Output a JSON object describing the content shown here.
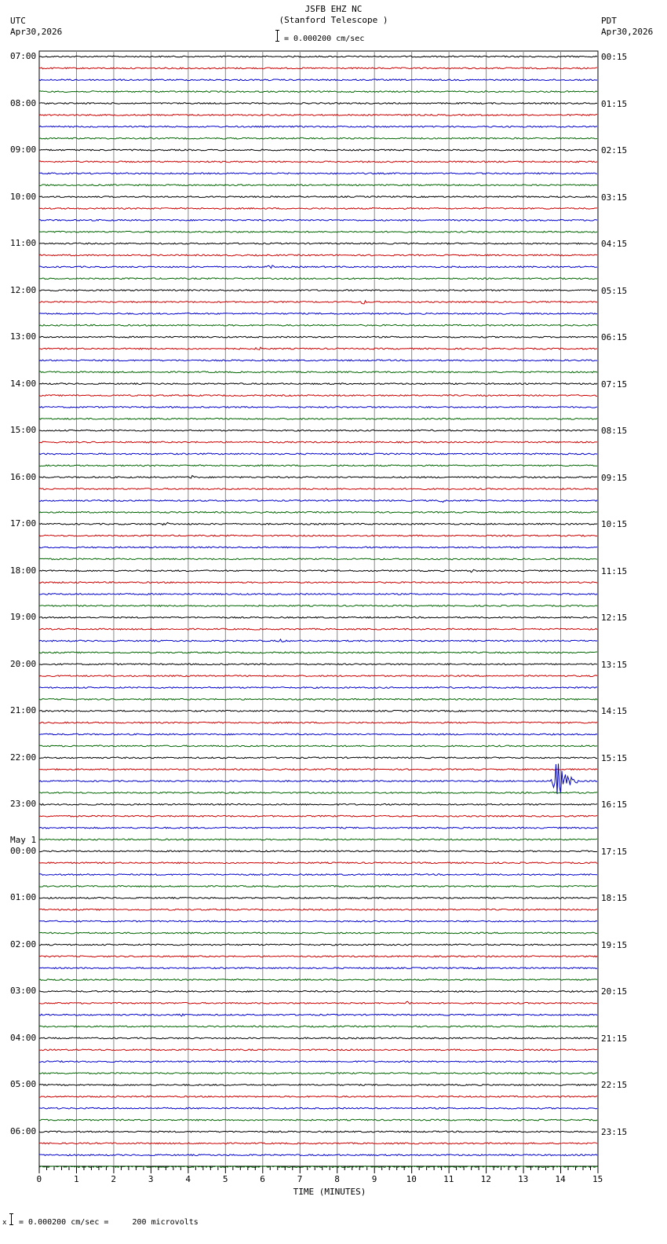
{
  "header": {
    "station": "JSFB EHZ NC",
    "site": "(Stanford Telescope )",
    "scale_text": "= 0.000200 cm/sec",
    "left_tz": "UTC",
    "left_date": "Apr30,2026",
    "right_tz": "PDT",
    "right_date": "Apr30,2026"
  },
  "footer": {
    "scale_text": "= 0.000200 cm/sec =     200 microvolts",
    "marker": "x"
  },
  "chart_data": {
    "type": "line",
    "title": "JSFB EHZ NC (Stanford Telescope )",
    "xlabel": "TIME (MINUTES)",
    "ylabel": "",
    "xlim": [
      0,
      15
    ],
    "x_ticks": [
      "0",
      "1",
      "2",
      "3",
      "4",
      "5",
      "6",
      "7",
      "8",
      "9",
      "10",
      "11",
      "12",
      "13",
      "14",
      "15"
    ],
    "grid": true,
    "trace_count": 96,
    "traces_per_hour": 4,
    "trace_colors": [
      "#000000",
      "#cc0000",
      "#0000cc",
      "#006600"
    ],
    "hour_labels_utc": [
      "07:00",
      "08:00",
      "09:00",
      "10:00",
      "11:00",
      "12:00",
      "13:00",
      "14:00",
      "15:00",
      "16:00",
      "17:00",
      "18:00",
      "19:00",
      "20:00",
      "21:00",
      "22:00",
      "23:00",
      "00:00",
      "01:00",
      "02:00",
      "03:00",
      "04:00",
      "05:00",
      "06:00"
    ],
    "date_change_label": "May 1",
    "hour_labels_pdt": [
      "00:15",
      "01:15",
      "02:15",
      "03:15",
      "04:15",
      "05:15",
      "06:15",
      "07:15",
      "08:15",
      "09:15",
      "10:15",
      "11:15",
      "12:15",
      "13:15",
      "14:15",
      "15:15",
      "16:15",
      "17:15",
      "18:15",
      "19:15",
      "20:15",
      "21:15",
      "22:15",
      "23:15"
    ],
    "events": [
      {
        "trace": 62,
        "minute": 13.9,
        "amplitude": "large",
        "color": "#0000cc"
      },
      {
        "trace": 18,
        "minute": 6.2,
        "amplitude": "small"
      },
      {
        "trace": 21,
        "minute": 8.7,
        "amplitude": "small"
      },
      {
        "trace": 25,
        "minute": 5.9,
        "amplitude": "small"
      },
      {
        "trace": 36,
        "minute": 4.1,
        "amplitude": "small"
      },
      {
        "trace": 38,
        "minute": 10.8,
        "amplitude": "small"
      },
      {
        "trace": 40,
        "minute": 3.4,
        "amplitude": "small"
      },
      {
        "trace": 44,
        "minute": 11.6,
        "amplitude": "small"
      },
      {
        "trace": 50,
        "minute": 6.5,
        "amplitude": "small"
      },
      {
        "trace": 81,
        "minute": 9.9,
        "amplitude": "small"
      },
      {
        "trace": 82,
        "minute": 3.8,
        "amplitude": "small"
      }
    ]
  }
}
